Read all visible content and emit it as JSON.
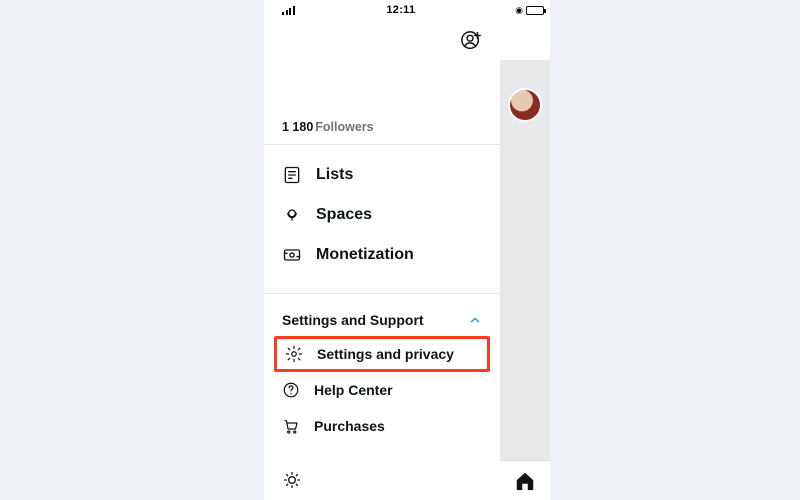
{
  "status": {
    "time": "12:11"
  },
  "followers": {
    "count": "1 180",
    "label": "Followers"
  },
  "menu": {
    "items": [
      {
        "label": "Lists"
      },
      {
        "label": "Spaces"
      },
      {
        "label": "Monetization"
      }
    ]
  },
  "support": {
    "header": "Settings and Support",
    "items": [
      {
        "label": "Settings and privacy"
      },
      {
        "label": "Help Center"
      },
      {
        "label": "Purchases"
      }
    ]
  }
}
